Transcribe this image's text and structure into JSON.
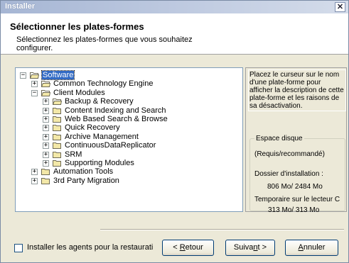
{
  "window": {
    "title": "Installer",
    "close_glyph": "✕"
  },
  "header": {
    "title": "Sélectionner les plates-formes",
    "subtitle": "Sélectionnez les plates-formes que vous souhaitez configurer."
  },
  "tree": [
    {
      "label": "Software",
      "expander": "−",
      "folder": "open",
      "selected": true
    },
    {
      "label": "Common Technology Engine",
      "expander": "+",
      "folder": "open"
    },
    {
      "label": "Client Modules",
      "expander": "−",
      "folder": "open"
    },
    {
      "label": "Backup & Recovery",
      "expander": "+",
      "folder": "open"
    },
    {
      "label": "Content Indexing and Search",
      "expander": "+",
      "folder": "closed"
    },
    {
      "label": "Web Based Search & Browse",
      "expander": "+",
      "folder": "closed"
    },
    {
      "label": "Quick Recovery",
      "expander": "+",
      "folder": "closed"
    },
    {
      "label": "Archive Management",
      "expander": "+",
      "folder": "closed"
    },
    {
      "label": "ContinuousDataReplicator",
      "expander": "+",
      "folder": "closed"
    },
    {
      "label": "SRM",
      "expander": "+",
      "folder": "closed"
    },
    {
      "label": "Supporting Modules",
      "expander": "+",
      "folder": "closed"
    },
    {
      "label": "Automation Tools",
      "expander": "+",
      "folder": "closed"
    },
    {
      "label": "3rd Party Migration",
      "expander": "+",
      "folder": "closed"
    }
  ],
  "description": "Placez le curseur sur le nom d'une plate-forme pour afficher la description de cette plate-forme et les raisons de sa désactivation.",
  "disk": {
    "legend": "Espace disque",
    "required_recommended": "(Requis/recommandé)",
    "install_folder_label": "Dossier d'installation :",
    "install_folder_value": "806 Mo/ 2484 Mo",
    "temp_label": "Temporaire sur le lecteur C",
    "temp_value": "313 Mo/ 313 Mo"
  },
  "footer": {
    "checkbox_label": "Installer les agents pour la restaurati",
    "checkbox_checked": false,
    "back_prefix": "< ",
    "back_mnemonic": "R",
    "back_rest": "etour",
    "next_prefix": "Suiva",
    "next_mnemonic": "n",
    "next_rest": "t >",
    "cancel_mnemonic": "A",
    "cancel_rest": "nnuler"
  },
  "colors": {
    "selection": "#316ac5",
    "folder_fill": "#f3e8a8",
    "folder_stroke": "#6e6a55"
  }
}
